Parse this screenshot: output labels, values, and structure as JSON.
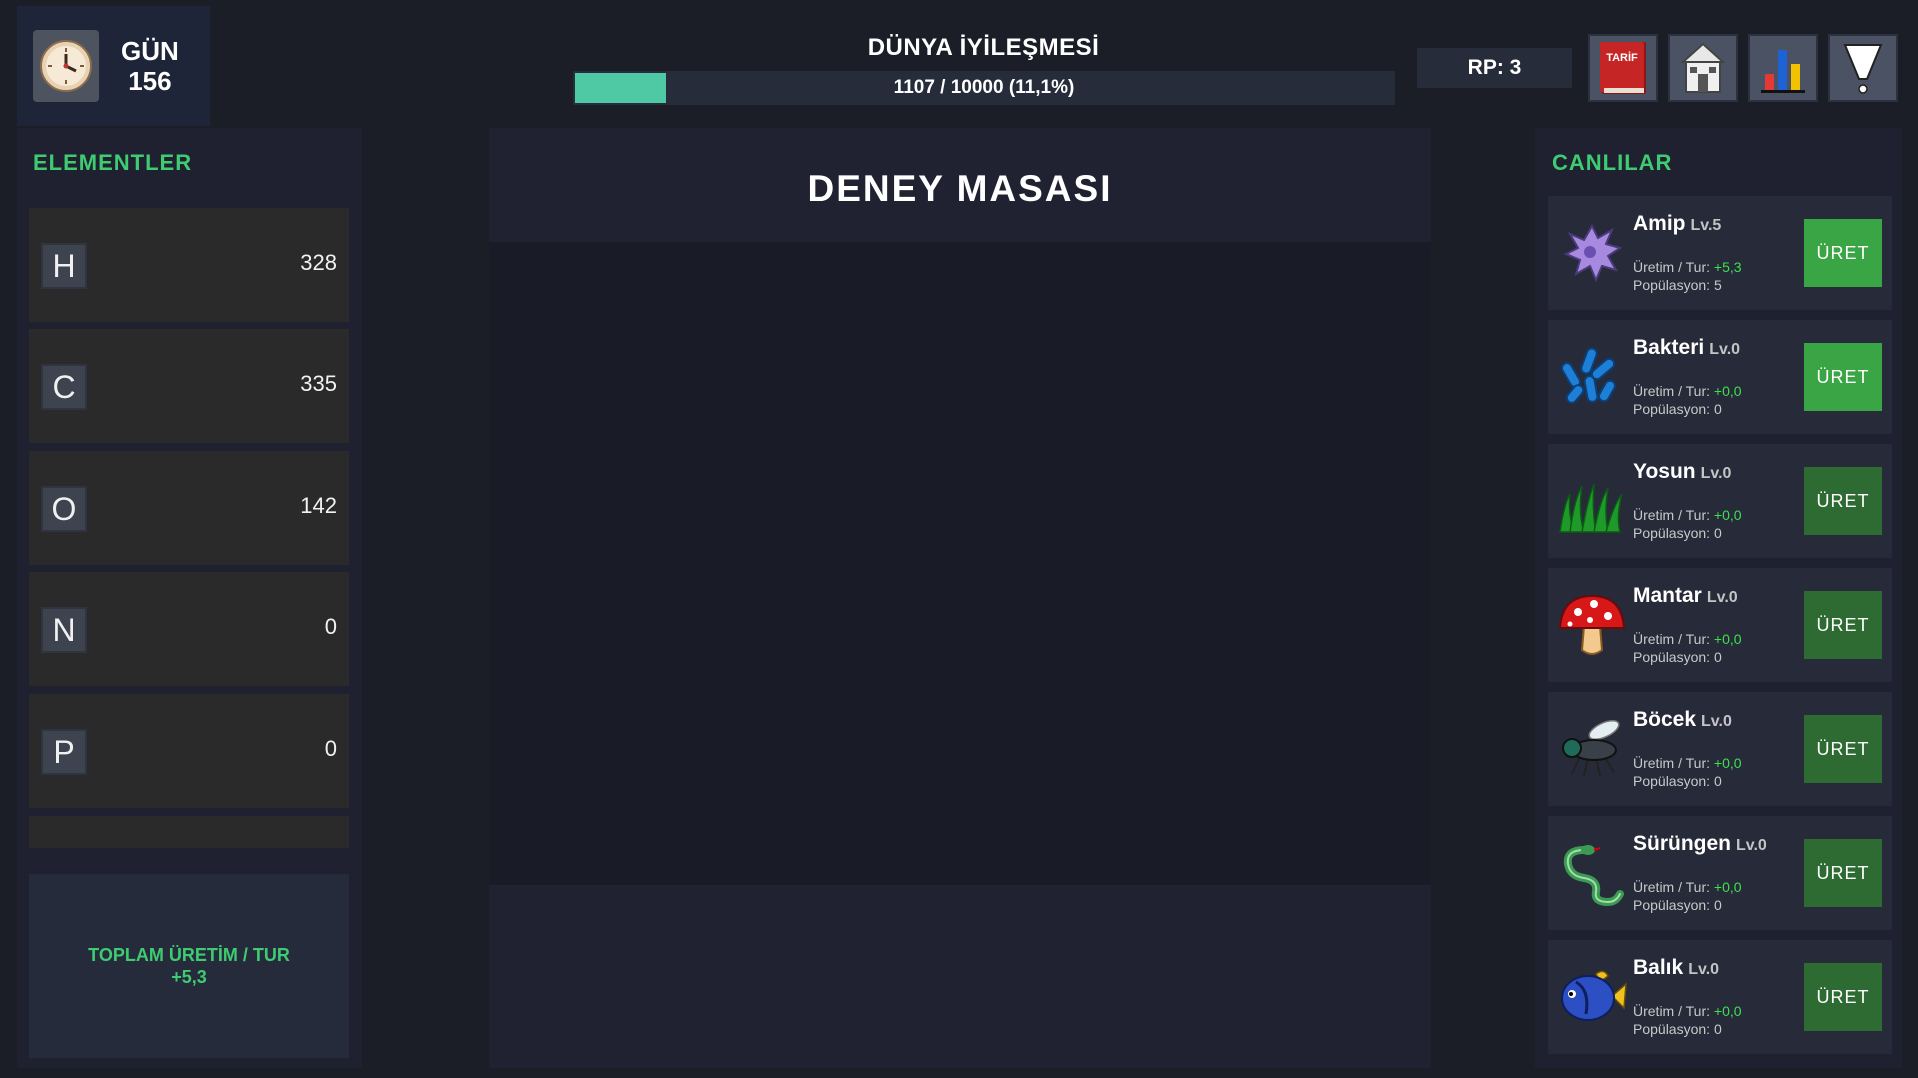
{
  "header": {
    "day_label": "GÜN",
    "day_value": "156",
    "world_title": "DÜNYA İYİLEŞMESİ",
    "world_progress_text": "1107 / 10000 (11,1%)",
    "world_progress_fraction": 0.111,
    "rp_text": "RP: 3",
    "recipe_book_label": "TARİF",
    "progress_color": "#4ec9a4"
  },
  "elements": {
    "heading": "ELEMENTLER",
    "items": [
      {
        "symbol": "H",
        "count": "328"
      },
      {
        "symbol": "C",
        "count": "335"
      },
      {
        "symbol": "O",
        "count": "142"
      },
      {
        "symbol": "N",
        "count": "0"
      },
      {
        "symbol": "P",
        "count": "0"
      }
    ],
    "total_label": "TOPLAM ÜRETİM / TUR",
    "total_value": "+5,3"
  },
  "center": {
    "title": "DENEY MASASI"
  },
  "creatures": {
    "heading": "CANLILAR",
    "produce_label": "ÜRET",
    "production_label": "Üretim / Tur:",
    "population_label": "Popülasyon:",
    "items": [
      {
        "name": "Amip",
        "level": "Lv.5",
        "production": "+5,3",
        "population": "5",
        "icon": "amoeba-icon",
        "enabled": true
      },
      {
        "name": "Bakteri",
        "level": "Lv.0",
        "production": "+0,0",
        "population": "0",
        "icon": "bacteria-icon",
        "enabled": true
      },
      {
        "name": "Yosun",
        "level": "Lv.0",
        "production": "+0,0",
        "population": "0",
        "icon": "algae-icon",
        "enabled": false
      },
      {
        "name": "Mantar",
        "level": "Lv.0",
        "production": "+0,0",
        "population": "0",
        "icon": "mushroom-icon",
        "enabled": false
      },
      {
        "name": "Böcek",
        "level": "Lv.0",
        "production": "+0,0",
        "population": "0",
        "icon": "fly-icon",
        "enabled": false
      },
      {
        "name": "Sürüngen",
        "level": "Lv.0",
        "production": "+0,0",
        "population": "0",
        "icon": "snake-icon",
        "enabled": false
      },
      {
        "name": "Balık",
        "level": "Lv.0",
        "production": "+0,0",
        "population": "0",
        "icon": "fish-icon",
        "enabled": false
      }
    ]
  }
}
